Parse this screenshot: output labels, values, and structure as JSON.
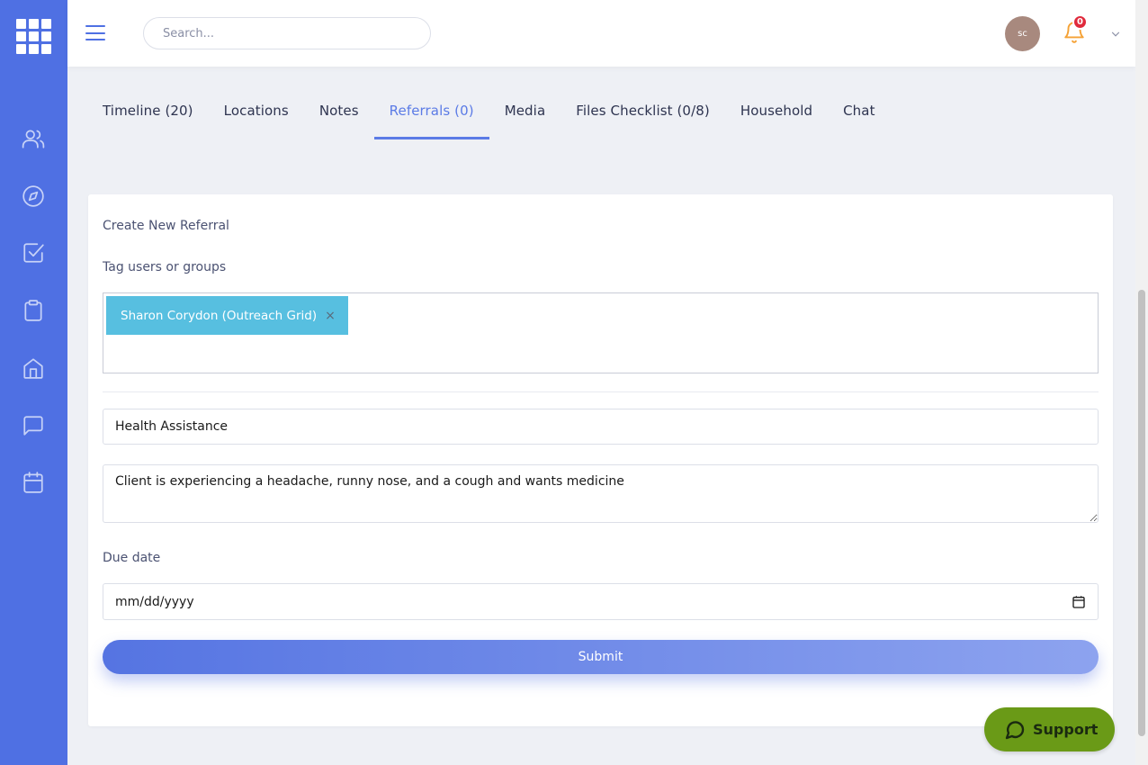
{
  "colors": {
    "rail": "#4f70e3",
    "accent": "#5b7be6",
    "chip": "#57bfe0",
    "support": "#6a9a17",
    "badge": "#e02a3c"
  },
  "rail": {
    "icons": [
      "users-icon",
      "compass-icon",
      "checkbox-icon",
      "clipboard-icon",
      "home-icon",
      "chat-bubble-icon",
      "calendar-icon"
    ]
  },
  "header": {
    "search_placeholder": "Search...",
    "avatar_initials": "sc",
    "notification_count": "0"
  },
  "tabs": [
    {
      "label": "Timeline (20)"
    },
    {
      "label": "Locations"
    },
    {
      "label": "Notes"
    },
    {
      "label": "Referrals (0)"
    },
    {
      "label": "Media"
    },
    {
      "label": "Files Checklist (0/8)"
    },
    {
      "label": "Household"
    },
    {
      "label": "Chat"
    }
  ],
  "active_tab": "Referrals (0)",
  "form": {
    "title": "Create New Referral",
    "tag_label": "Tag users or groups",
    "tagged": [
      {
        "name": "Sharon Corydon (Outreach Grid)",
        "remove": "×"
      }
    ],
    "subject_value": "Health Assistance",
    "description_value": "Client is experiencing a headache, runny nose, and a cough and wants medicine",
    "due_label": "Due date",
    "due_placeholder": "mm/dd/yyyy",
    "submit_label": "Submit"
  },
  "support": {
    "label": "Support"
  }
}
